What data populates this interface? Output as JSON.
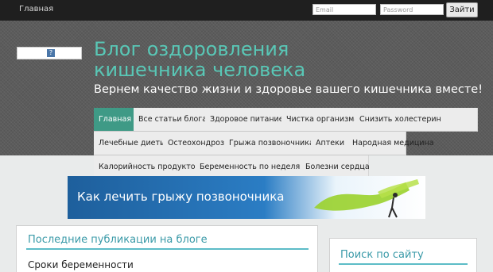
{
  "topbar": {
    "home_link": "Главная",
    "email_placeholder": "Email",
    "password_placeholder": "Password",
    "login_button": "Зайти"
  },
  "header": {
    "title": "Блог оздоровления кишечника человека",
    "tagline": "Вернем качество жизни и здоровье вашего кишечника вместе!",
    "logo_icon": "question-mark-icon"
  },
  "nav": {
    "row1": [
      "Главная",
      "Все статьи блога",
      "Здоровое питание",
      "Чистка организма",
      "Снизить холестерин"
    ],
    "row2": [
      "Лечебные диеты",
      "Остеохондроз",
      "Грыжа позвоночника",
      "Аптеки",
      "Народная медицина"
    ],
    "row3": [
      "Калорийность продуктов",
      "Беременность по неделям",
      "Болезни сердца"
    ],
    "active": "Главная"
  },
  "banner": {
    "text": "Как лечить грыжу позвоночника"
  },
  "main": {
    "section_title": "Последние публикации на блоге",
    "first_post": "Сроки беременности"
  },
  "sidebar": {
    "search_title": "Поиск по сайту"
  },
  "colors": {
    "accent": "#3f9a86",
    "title": "#59c7b6",
    "topbar": "#1f1f1f"
  }
}
